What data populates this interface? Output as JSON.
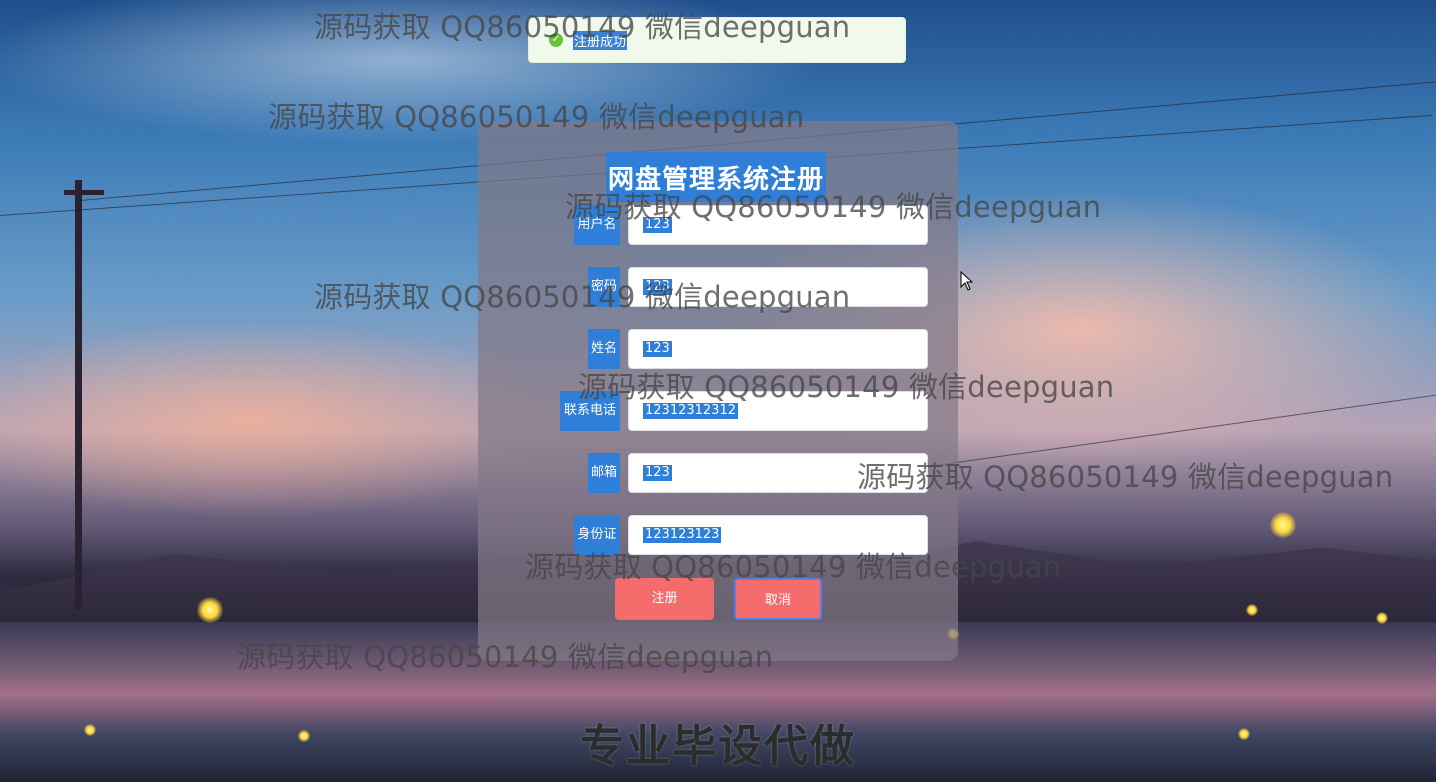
{
  "toast": {
    "icon": "success-check-icon",
    "message": "注册成功",
    "color": "#67c23a"
  },
  "form": {
    "title": "网盘管理系统注册",
    "fields": [
      {
        "label": "用户名",
        "value": "123"
      },
      {
        "label": "密码",
        "value": "123"
      },
      {
        "label": "姓名",
        "value": "123"
      },
      {
        "label": "联系电话",
        "value": "12312312312"
      },
      {
        "label": "邮箱",
        "value": "123"
      },
      {
        "label": "身份证",
        "value": "123123123"
      }
    ],
    "register_label": "注册",
    "cancel_label": "取消"
  },
  "watermark": {
    "text": "源码获取 QQ86050149 微信deepguan",
    "bottom_banner": "专业毕设代做"
  },
  "colors": {
    "accent": "#2f7fd8",
    "button": "#f56c6c",
    "toast_bg": "#f0f9eb"
  }
}
